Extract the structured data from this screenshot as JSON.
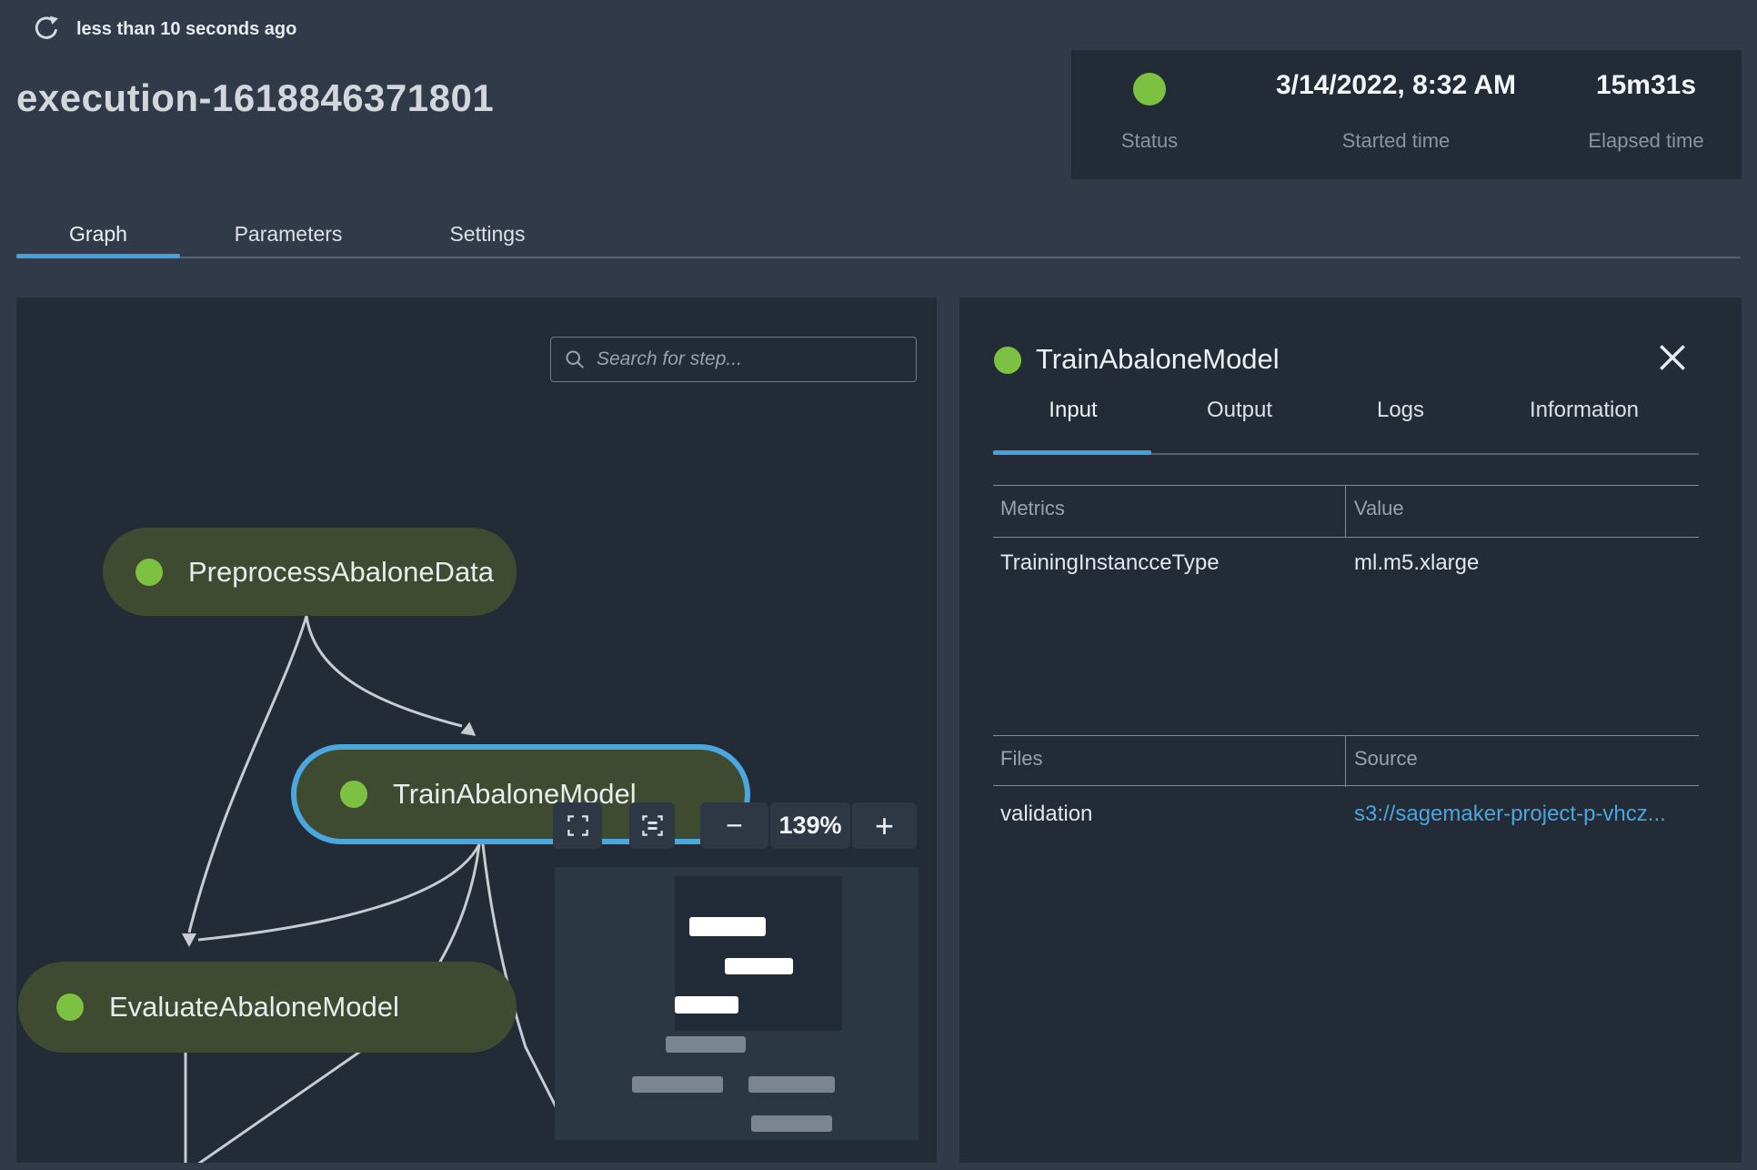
{
  "header": {
    "last_refreshed": "less than 10 seconds ago",
    "title": "execution-1618846371801"
  },
  "status_card": {
    "status_label": "Status",
    "started_label": "Started time",
    "started_value": "3/14/2022, 8:32 AM",
    "elapsed_label": "Elapsed time",
    "elapsed_value": "15m31s"
  },
  "main_tabs": {
    "graph": "Graph",
    "parameters": "Parameters",
    "settings": "Settings"
  },
  "graph": {
    "search_placeholder": "Search for step...",
    "zoom_percent": "139%",
    "zoom_out_glyph": "−",
    "zoom_in_glyph": "+",
    "nodes": [
      {
        "label": "PreprocessAbaloneData",
        "status": "completed"
      },
      {
        "label": "TrainAbaloneModel",
        "status": "completed",
        "selected": true
      },
      {
        "label": "EvaluateAbaloneModel",
        "status": "completed"
      }
    ]
  },
  "details": {
    "title": "TrainAbaloneModel",
    "tabs": {
      "input": "Input",
      "output": "Output",
      "logs": "Logs",
      "information": "Information"
    },
    "metrics_table": {
      "col1": "Metrics",
      "col2": "Value",
      "rows": [
        {
          "name": "TrainingInstancceType",
          "value": "ml.m5.xlarge"
        }
      ]
    },
    "files_table": {
      "col1": "Files",
      "col2": "Source",
      "rows": [
        {
          "name": "validation",
          "source": "s3://sagemaker-project-p-vhcz..."
        }
      ]
    }
  },
  "colors": {
    "accent_blue": "#44A1DC",
    "status_green": "#7DC142",
    "node_fill": "#3E4B30",
    "selected_border": "#4AA8DF",
    "link_blue": "#4BA6DC",
    "panel_bg": "#222B36",
    "page_bg": "#303A48"
  }
}
